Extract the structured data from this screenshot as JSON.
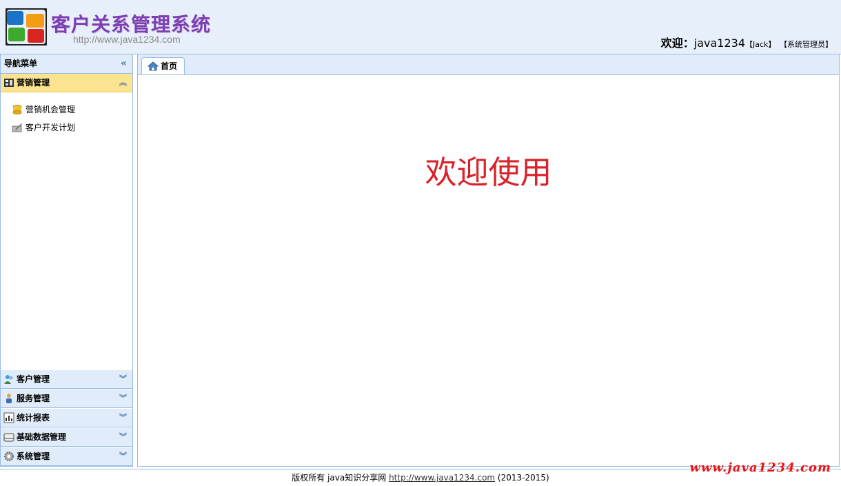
{
  "header": {
    "title": "客户关系管理系统",
    "url": "http://www.java1234.com",
    "welcome_label": "欢迎：",
    "username": "java1234",
    "realname": "【Jack】",
    "role": "【系统管理员】"
  },
  "sidebar": {
    "title": "导航菜单",
    "active_panel": {
      "label": "营销管理",
      "items": [
        {
          "label": "营销机会管理",
          "icon": "coins-icon"
        },
        {
          "label": "客户开发计划",
          "icon": "pencil-folder-icon"
        }
      ]
    },
    "panels": [
      {
        "label": "客户管理",
        "icon": "customers-icon"
      },
      {
        "label": "服务管理",
        "icon": "user-icon"
      },
      {
        "label": "统计报表",
        "icon": "chart-icon"
      },
      {
        "label": "基础数据管理",
        "icon": "drive-icon"
      },
      {
        "label": "系统管理",
        "icon": "gear-icon"
      }
    ]
  },
  "main": {
    "tab_label": "首页",
    "welcome_text": "欢迎使用"
  },
  "footer": {
    "prefix": "版权所有 java知识分享网 ",
    "link": "http://www.java1234.com",
    "suffix": " (2013-2015)"
  },
  "watermark": "www.java1234.com",
  "colors": {
    "header_bg": "#e6effa",
    "accent_border": "#99bbe8",
    "active_panel_bg": "#fbe38f",
    "title_purple": "#7b3fb0",
    "welcome_red": "#d9232a"
  }
}
